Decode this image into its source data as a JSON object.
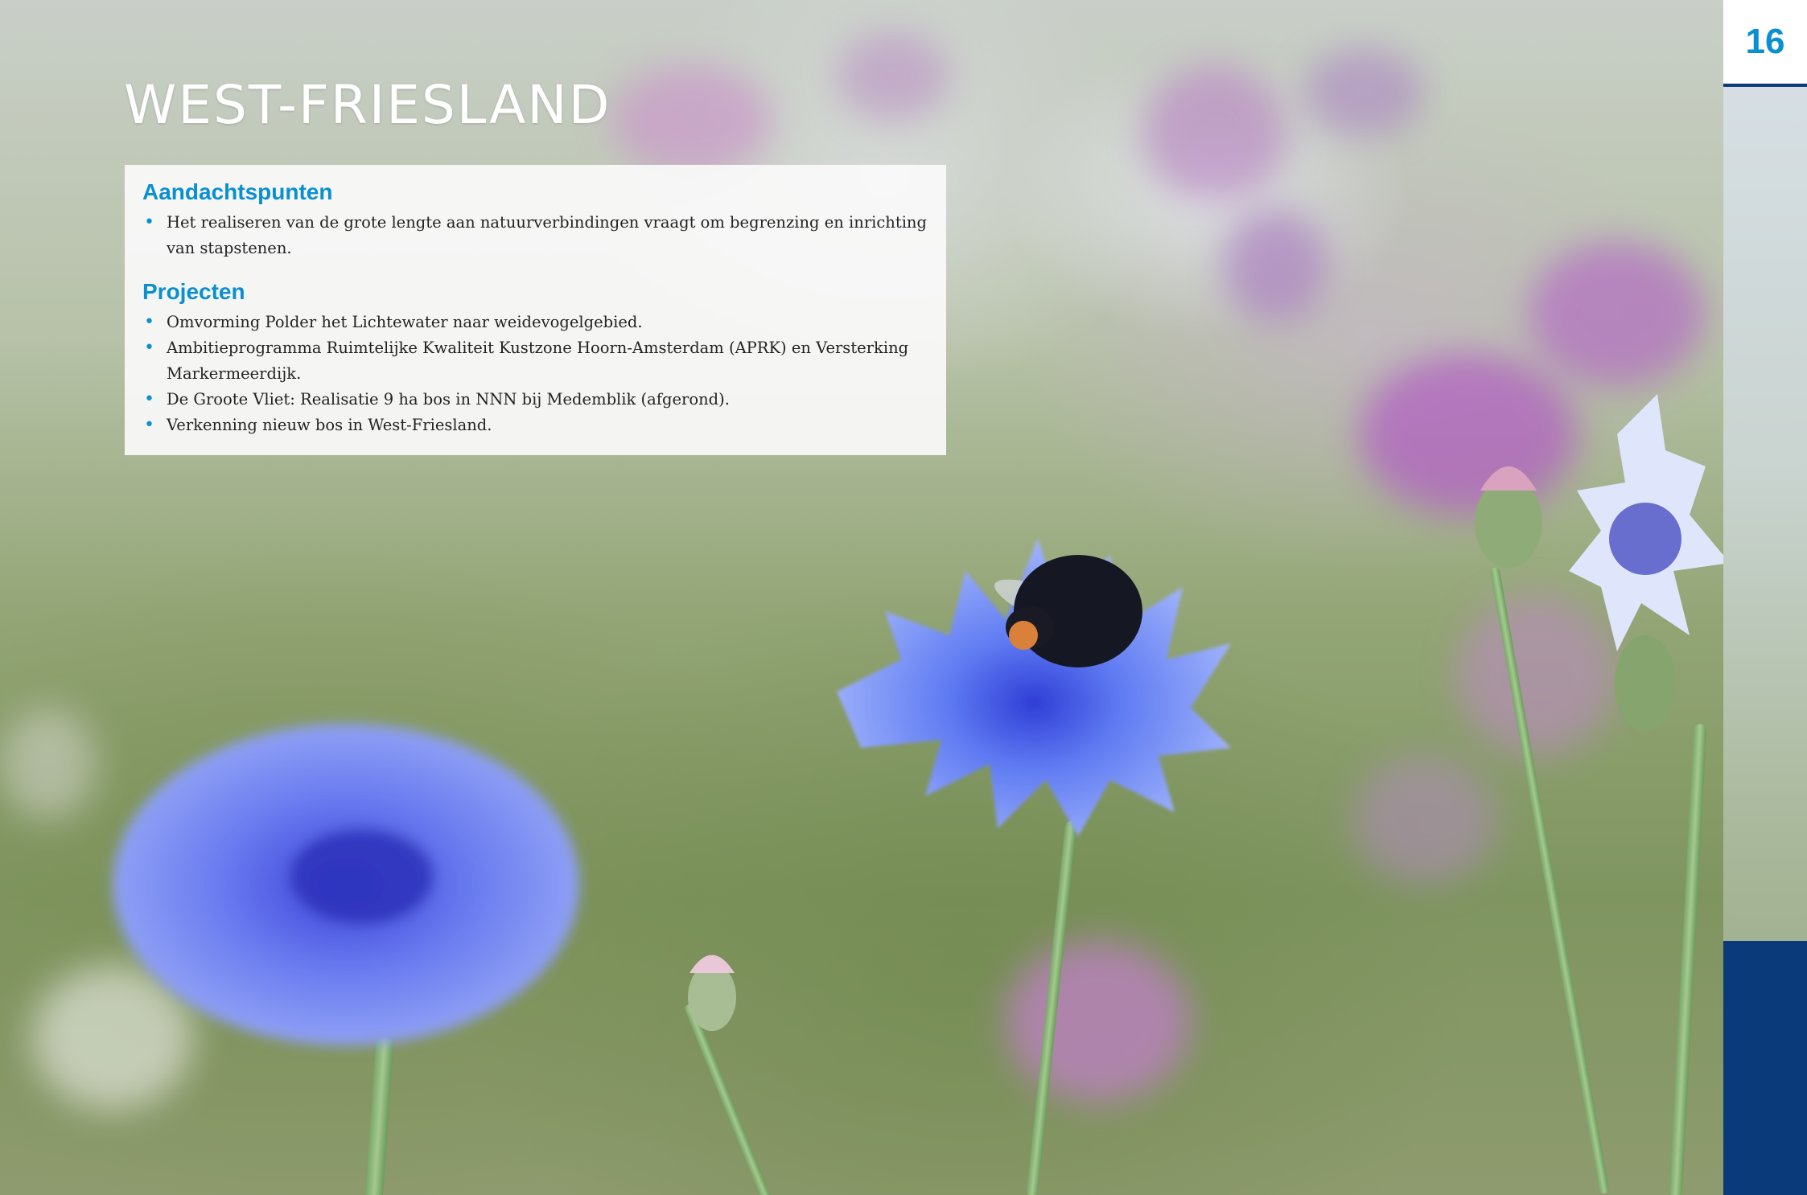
{
  "page": {
    "title": "WEST-FRIESLAND",
    "number": "16"
  },
  "panel": {
    "sections": [
      {
        "heading": "Aandachtspunten",
        "items": [
          "Het realiseren van de grote lengte aan natuurverbindingen vraagt om begrenzing en inrichting van stapstenen."
        ]
      },
      {
        "heading": "Projecten",
        "items": [
          "Omvorming Polder het Lichtewater naar weidevogelgebied.",
          "Ambitieprogramma Ruimtelijke Kwaliteit Kustzone Hoorn-Amsterdam (APRK) en Versterking Markermeerdijk.",
          "De Groote Vliet: Realisatie 9 ha bos in NNN bij Medemblik (afgerond).",
          "Verkenning nieuw bos in West-Friesland."
        ]
      }
    ]
  },
  "colors": {
    "accent_blue": "#0a8fd1",
    "navy": "#0b3a7a",
    "panel_bg": "#fafafa"
  },
  "background_image": "cornflowers-with-bumblebee-photo"
}
